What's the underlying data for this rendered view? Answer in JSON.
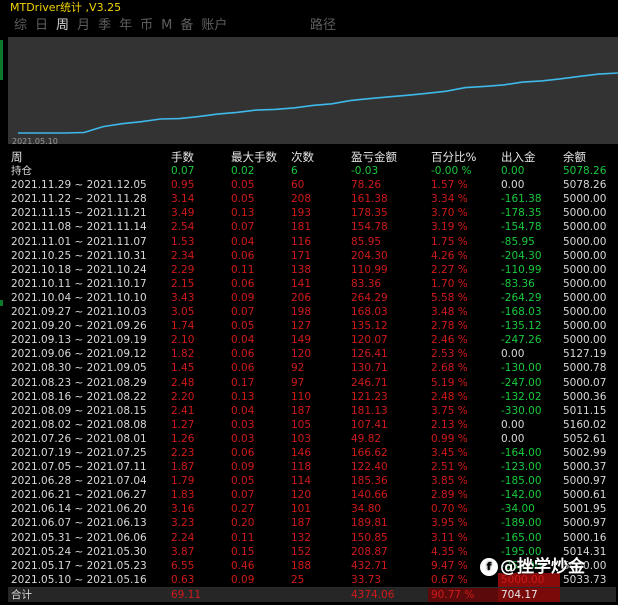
{
  "window": {
    "title": "MTDriver统计 ,V3.25"
  },
  "tabs": [
    "综",
    "日",
    "周",
    "月",
    "季",
    "年",
    "币",
    "M",
    "备",
    "账户"
  ],
  "active_tab": 2,
  "route_label": "路径",
  "chart": {
    "date_label": "2021.05.10",
    "line_color": "#3fb8ea"
  },
  "chart_data": {
    "type": "line",
    "x": [
      "2021.05.10",
      "2021.05.17",
      "2021.05.24",
      "2021.05.31",
      "2021.06.07",
      "2021.06.14",
      "2021.06.21",
      "2021.06.28",
      "2021.07.05",
      "2021.07.12",
      "2021.07.19",
      "2021.07.26",
      "2021.08.02",
      "2021.08.09",
      "2021.08.16",
      "2021.08.23",
      "2021.08.30",
      "2021.09.06",
      "2021.09.13",
      "2021.09.20",
      "2021.09.27",
      "2021.10.04",
      "2021.10.11",
      "2021.10.18",
      "2021.10.25",
      "2021.11.01",
      "2021.11.08",
      "2021.11.15",
      "2021.11.22",
      "2021.11.29"
    ],
    "series": [
      {
        "values": [
          0,
          33.73,
          466.44,
          674.31,
          824.31,
          1014.12,
          1048.92,
          1189.58,
          1375.13,
          1497.53,
          1665.15,
          1714.97,
          1822.38,
          2003.51,
          2124.74,
          2371.45,
          2502.16,
          2628.57,
          2749.64,
          2884.76,
          3037.79,
          3302.08,
          3385.44,
          3496.43,
          3700.73,
          3786.68,
          3941.46,
          4119.81,
          4281.19,
          4359.45
        ]
      }
    ]
  },
  "table": {
    "headers": [
      "周",
      "手数",
      "最大手数",
      "次数",
      "盈亏金额",
      "百分比%",
      "出入金",
      "余额"
    ],
    "position_row": [
      "持仓",
      "0.07",
      "0.02",
      "6",
      "-0.03",
      "-0.00 %",
      "0.00",
      "5078.26"
    ],
    "rows": [
      [
        "2021.11.29 ~ 2021.12.05",
        "0.95",
        "0.05",
        "60",
        "78.26",
        "1.57 %",
        "0.00",
        "5078.26"
      ],
      [
        "2021.11.22 ~ 2021.11.28",
        "3.14",
        "0.05",
        "208",
        "161.38",
        "3.34 %",
        "-161.38",
        "5000.00"
      ],
      [
        "2021.11.15 ~ 2021.11.21",
        "3.49",
        "0.13",
        "193",
        "178.35",
        "3.70 %",
        "-178.35",
        "5000.00"
      ],
      [
        "2021.11.08 ~ 2021.11.14",
        "2.54",
        "0.07",
        "181",
        "154.78",
        "3.19 %",
        "-154.78",
        "5000.00"
      ],
      [
        "2021.11.01 ~ 2021.11.07",
        "1.53",
        "0.04",
        "116",
        "85.95",
        "1.75 %",
        "-85.95",
        "5000.00"
      ],
      [
        "2021.10.25 ~ 2021.10.31",
        "2.34",
        "0.06",
        "171",
        "204.30",
        "4.26 %",
        "-204.30",
        "5000.00"
      ],
      [
        "2021.10.18 ~ 2021.10.24",
        "2.29",
        "0.11",
        "138",
        "110.99",
        "2.27 %",
        "-110.99",
        "5000.00"
      ],
      [
        "2021.10.11 ~ 2021.10.17",
        "2.15",
        "0.06",
        "141",
        "83.36",
        "1.70 %",
        "-83.36",
        "5000.00"
      ],
      [
        "2021.10.04 ~ 2021.10.10",
        "3.43",
        "0.09",
        "206",
        "264.29",
        "5.58 %",
        "-264.29",
        "5000.00"
      ],
      [
        "2021.09.27 ~ 2021.10.03",
        "3.05",
        "0.07",
        "198",
        "168.03",
        "3.48 %",
        "-168.03",
        "5000.00"
      ],
      [
        "2021.09.20 ~ 2021.09.26",
        "1.74",
        "0.05",
        "127",
        "135.12",
        "2.78 %",
        "-135.12",
        "5000.00"
      ],
      [
        "2021.09.13 ~ 2021.09.19",
        "2.10",
        "0.04",
        "149",
        "120.07",
        "2.46 %",
        "-247.26",
        "5000.00"
      ],
      [
        "2021.09.06 ~ 2021.09.12",
        "1.82",
        "0.06",
        "120",
        "126.41",
        "2.53 %",
        "0.00",
        "5127.19"
      ],
      [
        "2021.08.30 ~ 2021.09.05",
        "1.45",
        "0.06",
        "92",
        "130.71",
        "2.68 %",
        "-130.00",
        "5000.78"
      ],
      [
        "2021.08.23 ~ 2021.08.29",
        "2.48",
        "0.17",
        "97",
        "246.71",
        "5.19 %",
        "-247.00",
        "5000.07"
      ],
      [
        "2021.08.16 ~ 2021.08.22",
        "2.20",
        "0.13",
        "110",
        "121.23",
        "2.48 %",
        "-132.02",
        "5000.36"
      ],
      [
        "2021.08.09 ~ 2021.08.15",
        "2.41",
        "0.04",
        "187",
        "181.13",
        "3.75 %",
        "-330.00",
        "5011.15"
      ],
      [
        "2021.08.02 ~ 2021.08.08",
        "1.27",
        "0.03",
        "105",
        "107.41",
        "2.13 %",
        "0.00",
        "5160.02"
      ],
      [
        "2021.07.26 ~ 2021.08.01",
        "1.26",
        "0.03",
        "103",
        "49.82",
        "0.99 %",
        "0.00",
        "5052.61"
      ],
      [
        "2021.07.19 ~ 2021.07.25",
        "2.23",
        "0.06",
        "146",
        "166.62",
        "3.45 %",
        "-164.00",
        "5002.99"
      ],
      [
        "2021.07.05 ~ 2021.07.11",
        "1.87",
        "0.09",
        "118",
        "122.40",
        "2.51 %",
        "-123.00",
        "5000.37"
      ],
      [
        "2021.06.28 ~ 2021.07.04",
        "1.79",
        "0.05",
        "114",
        "185.36",
        "3.85 %",
        "-185.00",
        "5000.97"
      ],
      [
        "2021.06.21 ~ 2021.06.27",
        "1.83",
        "0.07",
        "120",
        "140.66",
        "2.89 %",
        "-142.00",
        "5000.61"
      ],
      [
        "2021.06.14 ~ 2021.06.20",
        "3.16",
        "0.27",
        "101",
        "34.80",
        "0.70 %",
        "-34.00",
        "5001.95"
      ],
      [
        "2021.06.07 ~ 2021.06.13",
        "3.23",
        "0.20",
        "187",
        "189.81",
        "3.95 %",
        "-189.00",
        "5000.97"
      ],
      [
        "2021.05.31 ~ 2021.06.06",
        "2.24",
        "0.11",
        "132",
        "150.85",
        "3.11 %",
        "-165.00",
        "5000.16"
      ],
      [
        "2021.05.24 ~ 2021.05.30",
        "3.87",
        "0.15",
        "152",
        "208.87",
        "4.35 %",
        "-195.00",
        "5014.31"
      ],
      [
        "2021.05.17 ~ 2021.05.23",
        "6.55",
        "0.46",
        "188",
        "432.71",
        "9.47 %",
        "-255.00",
        "5000.00"
      ],
      [
        "2021.05.10 ~ 2021.05.16",
        "0.63",
        "0.09",
        "25",
        "33.73",
        "0.67 %",
        "5000.00",
        "5033.73"
      ]
    ],
    "total_row": [
      "合计",
      "69.11",
      "",
      "",
      "4374.06",
      "90.77 %",
      "704.17",
      ""
    ]
  },
  "watermark": {
    "logo": "f",
    "text": "@挫学炒金"
  }
}
